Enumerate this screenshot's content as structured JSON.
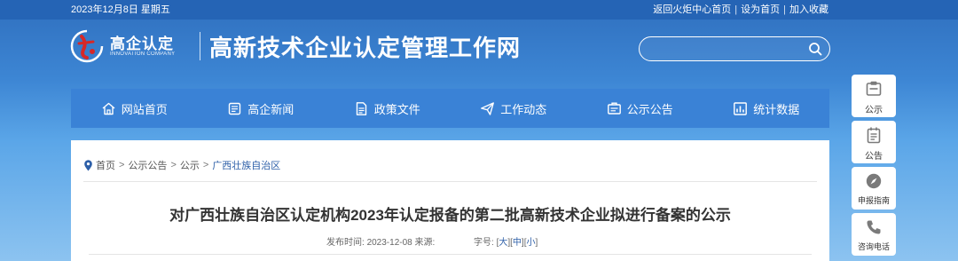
{
  "topbar": {
    "date": "2023年12月8日 星期五",
    "links": [
      "返回火炬中心首页",
      "设为首页",
      "加入收藏"
    ]
  },
  "header": {
    "logo_cn": "高企认定",
    "logo_en": "INNOVATION COMPANY",
    "site_title": "高新技术企业认定管理工作网"
  },
  "search": {
    "placeholder": "",
    "value": ""
  },
  "nav": [
    {
      "label": "网站首页",
      "icon": "home-icon"
    },
    {
      "label": "高企新闻",
      "icon": "news-icon"
    },
    {
      "label": "政策文件",
      "icon": "document-icon"
    },
    {
      "label": "工作动态",
      "icon": "send-icon"
    },
    {
      "label": "公示公告",
      "icon": "announcement-icon"
    },
    {
      "label": "统计数据",
      "icon": "chart-icon"
    }
  ],
  "breadcrumb": [
    "首页",
    "公示公告",
    "公示",
    "广西壮族自治区"
  ],
  "article": {
    "title": "对广西壮族自治区认定机构2023年认定报备的第二批高新技术企业拟进行备案的公示",
    "published_label": "发布时间:",
    "published_date": "2023-12-08",
    "source_label": "来源:",
    "font_size_label": "字号:",
    "font_sizes": [
      "大",
      "中",
      "小"
    ]
  },
  "float_bar": [
    {
      "label": "公示",
      "icon": "notice-icon"
    },
    {
      "label": "公告",
      "icon": "clipboard-icon"
    },
    {
      "label": "申报指南",
      "icon": "compass-icon"
    },
    {
      "label": "咨询电话",
      "icon": "phone-icon"
    }
  ],
  "colors": {
    "topbar": "#2564b5",
    "nav": "#3a82d6",
    "accent_link": "#2d5fa8",
    "logo_red": "#d62828"
  }
}
